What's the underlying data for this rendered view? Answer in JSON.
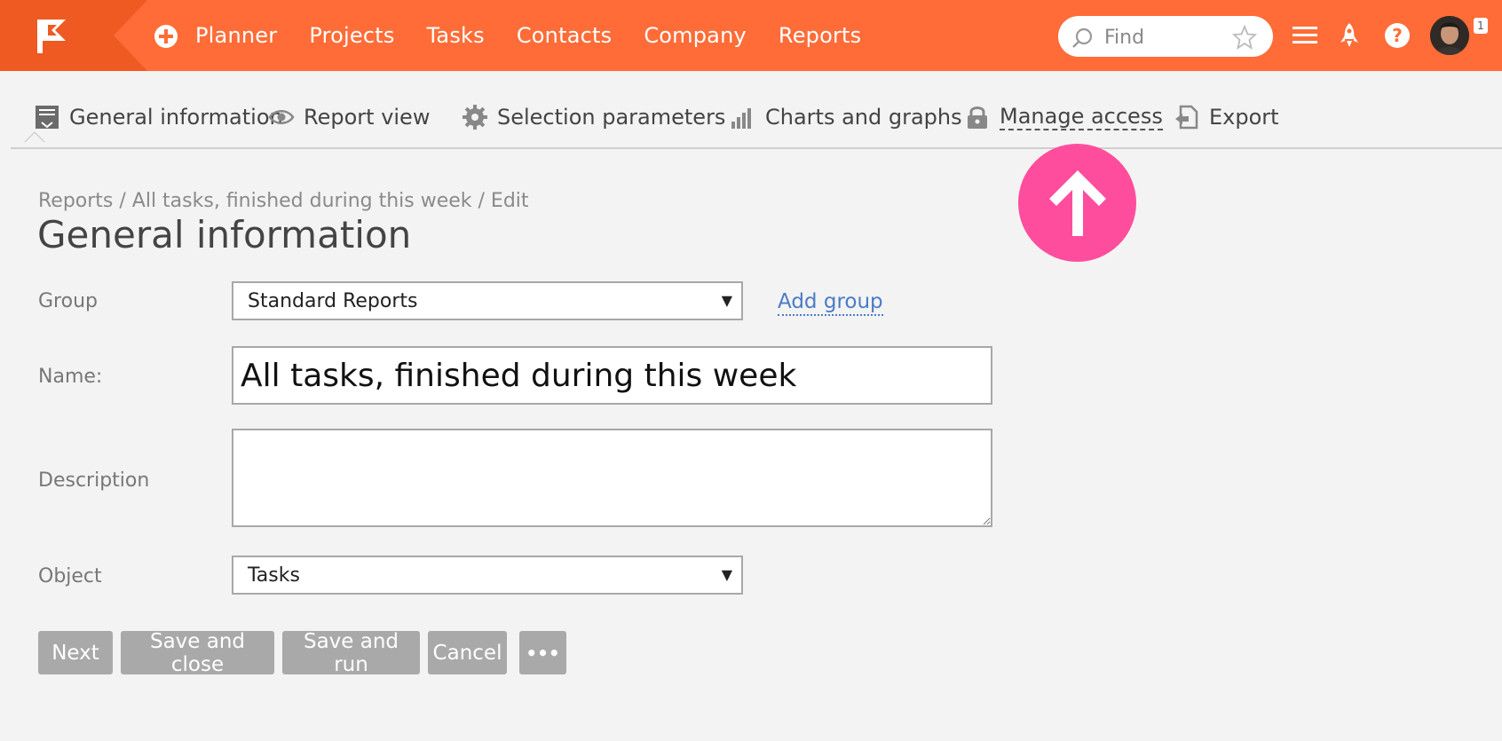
{
  "topbar": {
    "nav": [
      "Planner",
      "Projects",
      "Tasks",
      "Contacts",
      "Company",
      "Reports"
    ],
    "search_placeholder": "Find",
    "notification_count": "1",
    "icons": [
      "flag-logo-icon",
      "add-circle-icon",
      "search-icon",
      "star-icon",
      "menu-icon",
      "rocket-icon",
      "help-icon"
    ],
    "accent_color": "#ff6c37"
  },
  "tabs": [
    {
      "label": "General information",
      "icon": "form-icon"
    },
    {
      "label": "Report view",
      "icon": "eye-icon"
    },
    {
      "label": "Selection parameters",
      "icon": "gear-icon"
    },
    {
      "label": "Charts and graphs",
      "icon": "bar-chart-icon"
    },
    {
      "label": "Manage access",
      "icon": "lock-icon"
    },
    {
      "label": "Export",
      "icon": "export-icon"
    }
  ],
  "breadcrumb": "Reports / All tasks, finished during this week / Edit",
  "page_title": "General information",
  "form": {
    "group_label": "Group",
    "group_value": "Standard Reports",
    "add_group_label": "Add group",
    "name_label": "Name:",
    "name_value": "All tasks, finished during this week",
    "description_label": "Description",
    "description_value": "",
    "object_label": "Object",
    "object_value": "Tasks"
  },
  "buttons": {
    "next": "Next",
    "save_close": "Save and close",
    "save_run": "Save and run",
    "cancel": "Cancel",
    "more": "•••"
  },
  "overlay": {
    "icon": "arrow-up-icon",
    "color": "#ff4d9e"
  }
}
